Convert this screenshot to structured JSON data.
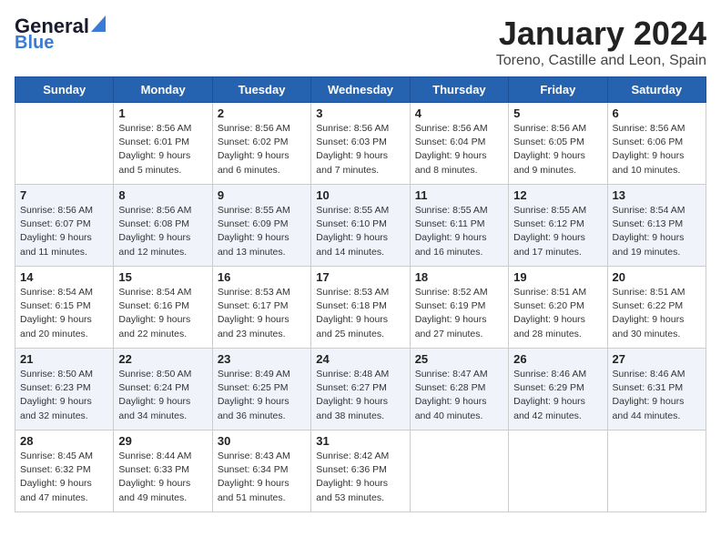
{
  "header": {
    "logo_general": "General",
    "logo_blue": "Blue",
    "month_title": "January 2024",
    "location": "Toreno, Castille and Leon, Spain"
  },
  "days_of_week": [
    "Sunday",
    "Monday",
    "Tuesday",
    "Wednesday",
    "Thursday",
    "Friday",
    "Saturday"
  ],
  "weeks": [
    [
      {
        "day": "",
        "sunrise": "",
        "sunset": "",
        "daylight": ""
      },
      {
        "day": "1",
        "sunrise": "Sunrise: 8:56 AM",
        "sunset": "Sunset: 6:01 PM",
        "daylight": "Daylight: 9 hours and 5 minutes."
      },
      {
        "day": "2",
        "sunrise": "Sunrise: 8:56 AM",
        "sunset": "Sunset: 6:02 PM",
        "daylight": "Daylight: 9 hours and 6 minutes."
      },
      {
        "day": "3",
        "sunrise": "Sunrise: 8:56 AM",
        "sunset": "Sunset: 6:03 PM",
        "daylight": "Daylight: 9 hours and 7 minutes."
      },
      {
        "day": "4",
        "sunrise": "Sunrise: 8:56 AM",
        "sunset": "Sunset: 6:04 PM",
        "daylight": "Daylight: 9 hours and 8 minutes."
      },
      {
        "day": "5",
        "sunrise": "Sunrise: 8:56 AM",
        "sunset": "Sunset: 6:05 PM",
        "daylight": "Daylight: 9 hours and 9 minutes."
      },
      {
        "day": "6",
        "sunrise": "Sunrise: 8:56 AM",
        "sunset": "Sunset: 6:06 PM",
        "daylight": "Daylight: 9 hours and 10 minutes."
      }
    ],
    [
      {
        "day": "7",
        "sunrise": "Sunrise: 8:56 AM",
        "sunset": "Sunset: 6:07 PM",
        "daylight": "Daylight: 9 hours and 11 minutes."
      },
      {
        "day": "8",
        "sunrise": "Sunrise: 8:56 AM",
        "sunset": "Sunset: 6:08 PM",
        "daylight": "Daylight: 9 hours and 12 minutes."
      },
      {
        "day": "9",
        "sunrise": "Sunrise: 8:55 AM",
        "sunset": "Sunset: 6:09 PM",
        "daylight": "Daylight: 9 hours and 13 minutes."
      },
      {
        "day": "10",
        "sunrise": "Sunrise: 8:55 AM",
        "sunset": "Sunset: 6:10 PM",
        "daylight": "Daylight: 9 hours and 14 minutes."
      },
      {
        "day": "11",
        "sunrise": "Sunrise: 8:55 AM",
        "sunset": "Sunset: 6:11 PM",
        "daylight": "Daylight: 9 hours and 16 minutes."
      },
      {
        "day": "12",
        "sunrise": "Sunrise: 8:55 AM",
        "sunset": "Sunset: 6:12 PM",
        "daylight": "Daylight: 9 hours and 17 minutes."
      },
      {
        "day": "13",
        "sunrise": "Sunrise: 8:54 AM",
        "sunset": "Sunset: 6:13 PM",
        "daylight": "Daylight: 9 hours and 19 minutes."
      }
    ],
    [
      {
        "day": "14",
        "sunrise": "Sunrise: 8:54 AM",
        "sunset": "Sunset: 6:15 PM",
        "daylight": "Daylight: 9 hours and 20 minutes."
      },
      {
        "day": "15",
        "sunrise": "Sunrise: 8:54 AM",
        "sunset": "Sunset: 6:16 PM",
        "daylight": "Daylight: 9 hours and 22 minutes."
      },
      {
        "day": "16",
        "sunrise": "Sunrise: 8:53 AM",
        "sunset": "Sunset: 6:17 PM",
        "daylight": "Daylight: 9 hours and 23 minutes."
      },
      {
        "day": "17",
        "sunrise": "Sunrise: 8:53 AM",
        "sunset": "Sunset: 6:18 PM",
        "daylight": "Daylight: 9 hours and 25 minutes."
      },
      {
        "day": "18",
        "sunrise": "Sunrise: 8:52 AM",
        "sunset": "Sunset: 6:19 PM",
        "daylight": "Daylight: 9 hours and 27 minutes."
      },
      {
        "day": "19",
        "sunrise": "Sunrise: 8:51 AM",
        "sunset": "Sunset: 6:20 PM",
        "daylight": "Daylight: 9 hours and 28 minutes."
      },
      {
        "day": "20",
        "sunrise": "Sunrise: 8:51 AM",
        "sunset": "Sunset: 6:22 PM",
        "daylight": "Daylight: 9 hours and 30 minutes."
      }
    ],
    [
      {
        "day": "21",
        "sunrise": "Sunrise: 8:50 AM",
        "sunset": "Sunset: 6:23 PM",
        "daylight": "Daylight: 9 hours and 32 minutes."
      },
      {
        "day": "22",
        "sunrise": "Sunrise: 8:50 AM",
        "sunset": "Sunset: 6:24 PM",
        "daylight": "Daylight: 9 hours and 34 minutes."
      },
      {
        "day": "23",
        "sunrise": "Sunrise: 8:49 AM",
        "sunset": "Sunset: 6:25 PM",
        "daylight": "Daylight: 9 hours and 36 minutes."
      },
      {
        "day": "24",
        "sunrise": "Sunrise: 8:48 AM",
        "sunset": "Sunset: 6:27 PM",
        "daylight": "Daylight: 9 hours and 38 minutes."
      },
      {
        "day": "25",
        "sunrise": "Sunrise: 8:47 AM",
        "sunset": "Sunset: 6:28 PM",
        "daylight": "Daylight: 9 hours and 40 minutes."
      },
      {
        "day": "26",
        "sunrise": "Sunrise: 8:46 AM",
        "sunset": "Sunset: 6:29 PM",
        "daylight": "Daylight: 9 hours and 42 minutes."
      },
      {
        "day": "27",
        "sunrise": "Sunrise: 8:46 AM",
        "sunset": "Sunset: 6:31 PM",
        "daylight": "Daylight: 9 hours and 44 minutes."
      }
    ],
    [
      {
        "day": "28",
        "sunrise": "Sunrise: 8:45 AM",
        "sunset": "Sunset: 6:32 PM",
        "daylight": "Daylight: 9 hours and 47 minutes."
      },
      {
        "day": "29",
        "sunrise": "Sunrise: 8:44 AM",
        "sunset": "Sunset: 6:33 PM",
        "daylight": "Daylight: 9 hours and 49 minutes."
      },
      {
        "day": "30",
        "sunrise": "Sunrise: 8:43 AM",
        "sunset": "Sunset: 6:34 PM",
        "daylight": "Daylight: 9 hours and 51 minutes."
      },
      {
        "day": "31",
        "sunrise": "Sunrise: 8:42 AM",
        "sunset": "Sunset: 6:36 PM",
        "daylight": "Daylight: 9 hours and 53 minutes."
      },
      {
        "day": "",
        "sunrise": "",
        "sunset": "",
        "daylight": ""
      },
      {
        "day": "",
        "sunrise": "",
        "sunset": "",
        "daylight": ""
      },
      {
        "day": "",
        "sunrise": "",
        "sunset": "",
        "daylight": ""
      }
    ]
  ]
}
